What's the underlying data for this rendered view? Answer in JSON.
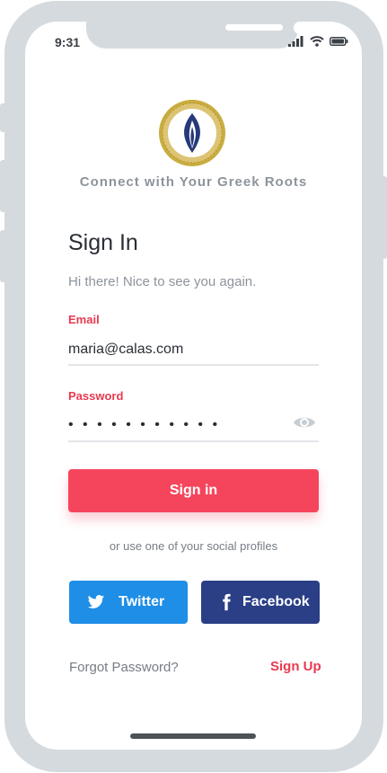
{
  "status_bar": {
    "time": "9:31"
  },
  "brand": {
    "logo_icon": "flame-emblem-icon",
    "tagline": "Connect with Your Greek Roots",
    "colors": {
      "gold": "#c9ac3f",
      "navy": "#263a7a"
    }
  },
  "signin": {
    "title": "Sign In",
    "subtitle": "Hi there! Nice to see you again.",
    "email_label": "Email",
    "email_value": "maria@calas.com",
    "password_label": "Password",
    "password_value": "• • • • • • • • • • •",
    "password_toggle_icon": "eye-icon",
    "submit_label": "Sign in",
    "social_hint": "or use one of your social profiles",
    "twitter_label": "Twitter",
    "facebook_label": "Facebook",
    "forgot_label": "Forgot Password?",
    "signup_label": "Sign Up"
  },
  "colors": {
    "accent": "#f5455c",
    "twitter": "#1e8ee7",
    "facebook": "#2b3f86",
    "muted_text": "#8d949c",
    "frame": "#d5dade"
  }
}
